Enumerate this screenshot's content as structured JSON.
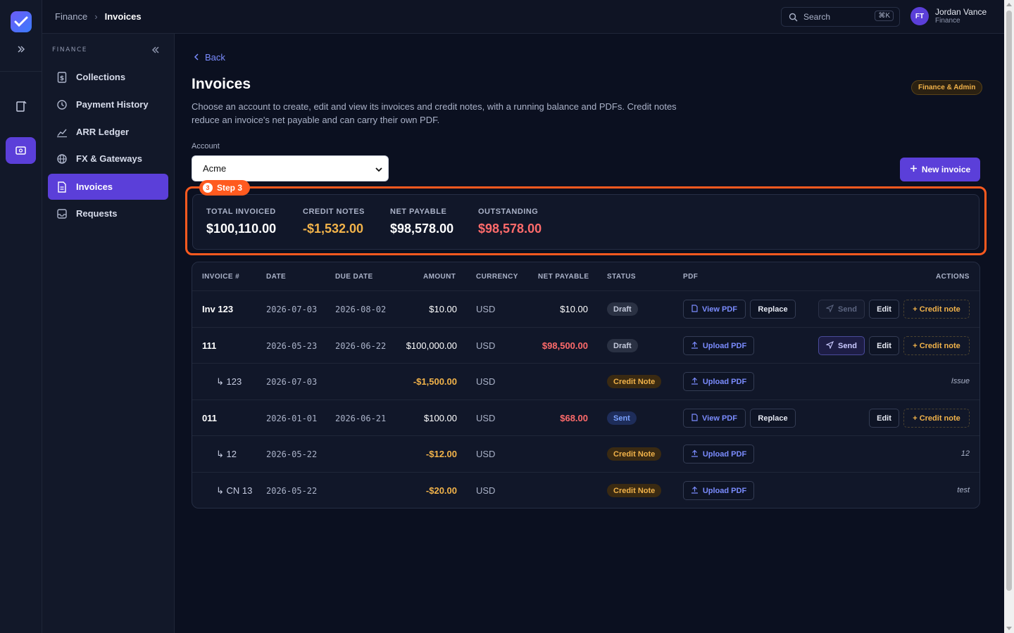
{
  "topbar": {
    "crumb_parent": "Finance",
    "crumb_current": "Invoices",
    "search_label": "Search",
    "search_shortcut": "⌘K",
    "user_initials": "FT",
    "user_name": "Jordan Vance",
    "user_role": "Finance"
  },
  "sidebar": {
    "section": "FINANCE",
    "items": [
      {
        "label": "Collections",
        "icon": "dollar-doc-icon"
      },
      {
        "label": "Payment History",
        "icon": "history-icon"
      },
      {
        "label": "ARR Ledger",
        "icon": "chart-line-icon"
      },
      {
        "label": "FX & Gateways",
        "icon": "globe-icon"
      },
      {
        "label": "Invoices",
        "icon": "invoice-icon",
        "active": true
      },
      {
        "label": "Requests",
        "icon": "inbox-icon"
      }
    ]
  },
  "page": {
    "back_label": "Back",
    "title": "Invoices",
    "description": "Choose an account to create, edit and view its invoices and credit notes, with a running balance and PDFs. Credit notes reduce an invoice's net payable and can carry their own PDF.",
    "role_badge": "Finance & Admin",
    "account_label": "Account",
    "account_value": "Acme",
    "new_invoice_label": "New invoice"
  },
  "step": {
    "number": "3",
    "label": "Step 3"
  },
  "summary": {
    "total_invoiced_label": "TOTAL INVOICED",
    "total_invoiced": "$100,110.00",
    "credit_notes_label": "CREDIT NOTES",
    "credit_notes": "-$1,532.00",
    "net_payable_label": "NET PAYABLE",
    "net_payable": "$98,578.00",
    "outstanding_label": "OUTSTANDING",
    "outstanding": "$98,578.00"
  },
  "table": {
    "headers": [
      "INVOICE #",
      "DATE",
      "DUE DATE",
      "AMOUNT",
      "CURRENCY",
      "NET PAYABLE",
      "STATUS",
      "PDF",
      "ACTIONS"
    ],
    "rows": [
      {
        "invoice": "Inv 123",
        "date": "2026-07-03",
        "due": "2026-08-02",
        "amount": "$10.00",
        "currency": "USD",
        "net": "$10.00",
        "status": "Draft",
        "pdf": "View PDF",
        "replace": "Replace",
        "send": "Send",
        "edit": "Edit",
        "credit": "+ Credit note"
      },
      {
        "invoice": "111",
        "date": "2026-05-23",
        "due": "2026-06-22",
        "amount": "$100,000.00",
        "currency": "USD",
        "net": "$98,500.00",
        "status": "Draft",
        "pdf": "Upload PDF",
        "send": "Send",
        "edit": "Edit",
        "credit": "+ Credit note"
      },
      {
        "invoice": "↳ 123",
        "date": "2026-07-03",
        "amount": "-$1,500.00",
        "currency": "USD",
        "status": "Credit Note",
        "pdf": "Upload PDF",
        "note": "Issue"
      },
      {
        "invoice": "011",
        "date": "2026-01-01",
        "due": "2026-06-21",
        "amount": "$100.00",
        "currency": "USD",
        "net": "$68.00",
        "status": "Sent",
        "pdf": "View PDF",
        "replace": "Replace",
        "edit": "Edit",
        "credit": "+ Credit note"
      },
      {
        "invoice": "↳ 12",
        "date": "2026-05-22",
        "amount": "-$12.00",
        "currency": "USD",
        "status": "Credit Note",
        "pdf": "Upload PDF",
        "note": "12"
      },
      {
        "invoice": "↳ CN 13",
        "date": "2026-05-22",
        "amount": "-$20.00",
        "currency": "USD",
        "status": "Credit Note",
        "pdf": "Upload PDF",
        "note": "test"
      }
    ]
  },
  "colors": {
    "accent": "#5b3fd9",
    "link": "#7b8cff",
    "warning": "#f2b34a",
    "danger": "#ff6b6b",
    "step": "#ff5a1f"
  }
}
